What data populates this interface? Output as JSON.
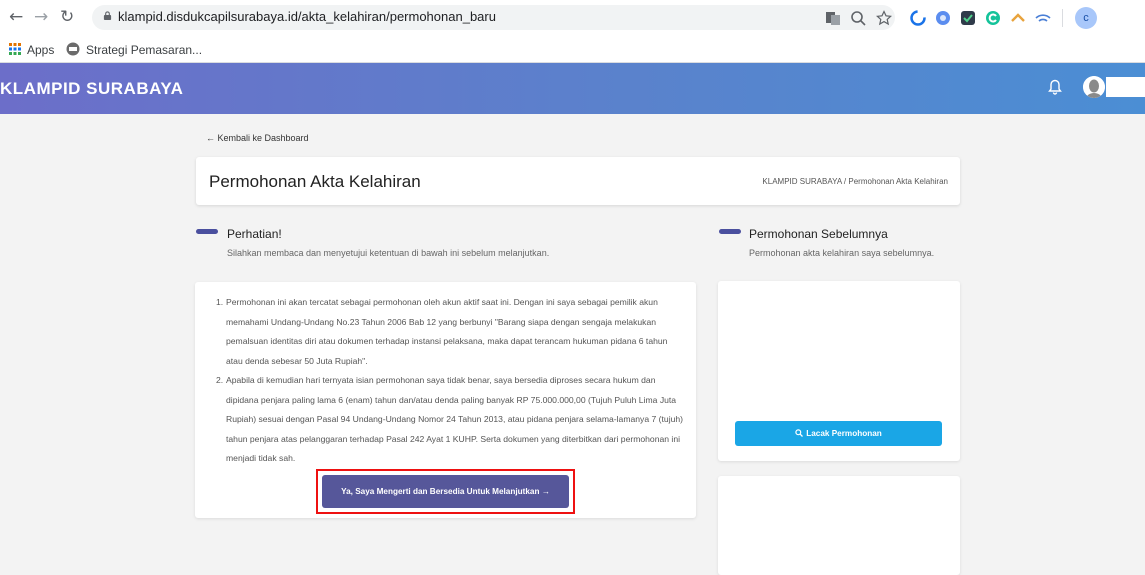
{
  "browser": {
    "url": "klampid.disdukcapilsurabaya.id/akta_kelahiran/permohonan_baru",
    "bookmarks": [
      "Apps",
      "Strategi Pemasaran..."
    ],
    "profile_initial": "c"
  },
  "header": {
    "brand": "KLAMPID SURABAYA"
  },
  "page": {
    "back_link": "← Kembali ke Dashboard",
    "title": "Permohonan Akta Kelahiran",
    "breadcrumb": "KLAMPID SURABAYA  /  Permohonan Akta Kelahiran"
  },
  "notice": {
    "title": "Perhatian!",
    "subtitle": "Silahkan membaca dan menyetujui ketentuan di bawah ini sebelum melanjutkan.",
    "terms": [
      {
        "num": "1.",
        "text": "Permohonan ini akan tercatat sebagai permohonan oleh akun aktif saat ini. Dengan ini saya sebagai pemilik akun memahami Undang-Undang No.23 Tahun 2006 Bab 12 yang berbunyi \"Barang siapa dengan sengaja melakukan pemalsuan identitas diri atau dokumen terhadap instansi pelaksana, maka dapat terancam hukuman pidana 6 tahun atau denda sebesar 50 Juta Rupiah\"."
      },
      {
        "num": "2.",
        "text": "Apabila di kemudian hari ternyata isian permohonan saya tidak benar, saya bersedia diproses secara hukum dan dipidana penjara paling lama 6 (enam) tahun dan/atau denda paling banyak RP 75.000.000,00 (Tujuh Puluh Lima Juta Rupiah) sesuai dengan Pasal 94 Undang-Undang Nomor 24 Tahun 2013, atau pidana penjara selama-lamanya 7 (tujuh) tahun penjara atas pelanggaran terhadap Pasal 242 Ayat 1 KUHP. Serta dokumen yang diterbitkan dari permohonan ini menjadi tidak sah."
      }
    ],
    "agree_button": "Ya, Saya Mengerti dan Bersedia Untuk Melanjutkan →"
  },
  "previous": {
    "title": "Permohonan Sebelumnya",
    "subtitle": "Permohonan akta kelahiran saya sebelumnya.",
    "track_button": "Lacak Permohonan"
  },
  "colors": {
    "header_start": "#6c6ec9",
    "header_end": "#4b8ed4",
    "primary_button": "#56579a",
    "track_button": "#1aa6e6",
    "highlight_frame": "#ee1111"
  }
}
